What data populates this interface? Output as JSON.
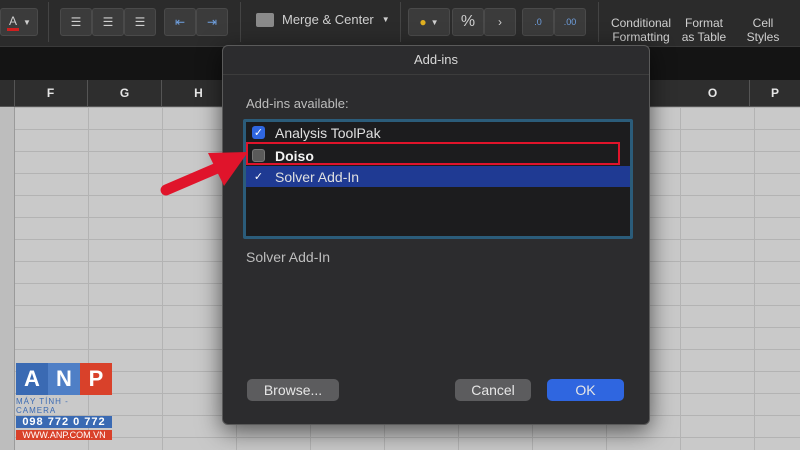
{
  "ribbon": {
    "merge_center": "Merge & Center",
    "percent": "%",
    "conditional_formatting": [
      "Conditional",
      "Formatting"
    ],
    "format_as_table": [
      "Format",
      "as Table"
    ],
    "cell_styles": [
      "Cell",
      "Styles"
    ],
    "font_color_letter": "A"
  },
  "columns": [
    "F",
    "G",
    "H",
    "O",
    "P"
  ],
  "dialog": {
    "title": "Add-ins",
    "available_label": "Add-ins available:",
    "items": [
      {
        "label": "Analysis ToolPak",
        "checked": true,
        "selected": false
      },
      {
        "label": "Doiso",
        "checked": false,
        "selected": false
      },
      {
        "label": "Solver Add-In",
        "checked": true,
        "selected": true
      }
    ],
    "description": "Solver Add-In",
    "browse_label": "Browse...",
    "cancel_label": "Cancel",
    "ok_label": "OK"
  },
  "watermark": {
    "letters": [
      "A",
      "N",
      "P"
    ],
    "subtitle": "MÁY TÍNH - CAMERA",
    "phone": "098 772 0 772",
    "website": "WWW.ANP.COM.VN"
  },
  "colors": {
    "selection": "#1f3a93",
    "ok_button": "#2f66e0",
    "highlight": "#e0142b",
    "list_border": "#2b5c7a"
  }
}
